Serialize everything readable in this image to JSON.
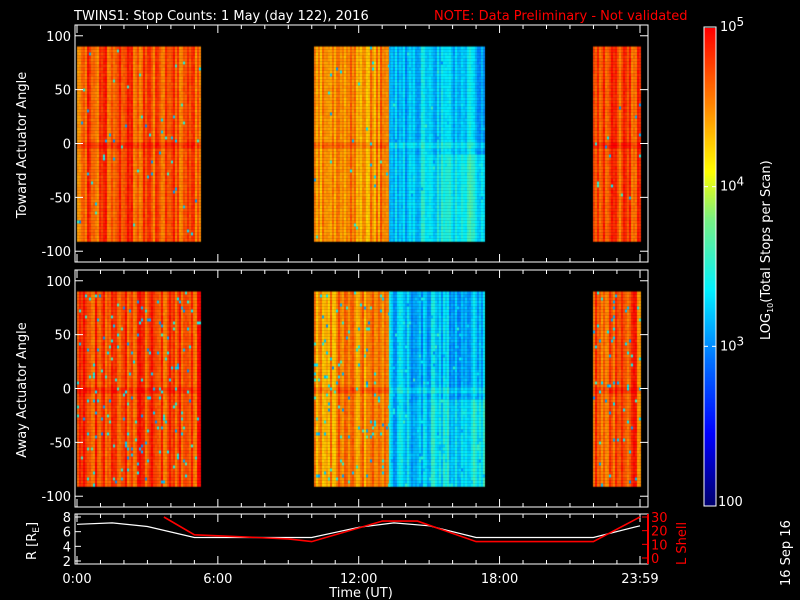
{
  "title": {
    "main": "TWINS1: Stop Counts:  1 May (day 122), 2016",
    "note": "NOTE: Data Preliminary - Not validated",
    "note_color": "#ff0000"
  },
  "chart_data": [
    {
      "type": "heatmap",
      "name": "toward",
      "ylabel": "Toward Actuator Angle",
      "ylim": [
        -110,
        110
      ],
      "yticks": [
        "100",
        "50",
        "0",
        "-50",
        "-100"
      ],
      "ytick_values": [
        100,
        50,
        0,
        -50,
        -100
      ],
      "angle_range": [
        -90,
        90
      ],
      "segments": [
        {
          "start_h": 0.0,
          "end_h": 5.3,
          "log10_counts": 4.7,
          "note": "orange/red with yellow stripes"
        },
        {
          "start_h": 10.1,
          "end_h": 13.3,
          "log10_counts": 4.5
        },
        {
          "start_h": 13.3,
          "end_h": 17.4,
          "log10_counts": 3.2
        },
        {
          "start_h": 22.0,
          "end_h": 24.0,
          "log10_counts": 4.7
        }
      ]
    },
    {
      "type": "heatmap",
      "name": "away",
      "ylabel": "Away Actuator Angle",
      "ylim": [
        -110,
        110
      ],
      "yticks": [
        "100",
        "50",
        "0",
        "-50",
        "-100"
      ],
      "ytick_values": [
        100,
        50,
        0,
        -50,
        -100
      ],
      "angle_range": [
        -90,
        90
      ],
      "segments": [
        {
          "start_h": 0.0,
          "end_h": 5.3,
          "log10_counts": 4.75
        },
        {
          "start_h": 10.1,
          "end_h": 13.3,
          "log10_counts": 4.5
        },
        {
          "start_h": 13.3,
          "end_h": 17.4,
          "log10_counts": 3.2
        },
        {
          "start_h": 22.0,
          "end_h": 24.0,
          "log10_counts": 4.7
        }
      ]
    },
    {
      "type": "line",
      "name": "orbit",
      "ylabel_left": "R [R",
      "ylabel_left_sub": "E",
      "ylabel_left_end": "]",
      "ylim_left": [
        2,
        8
      ],
      "yticks_left": [
        "8",
        "6",
        "4",
        "2"
      ],
      "ylabel_right": "L Shell",
      "ylim_right": [
        0,
        30
      ],
      "yticks_right": [
        "30",
        "20",
        "10",
        "0"
      ],
      "xlabel": "Time (UT)",
      "xlim": [
        0,
        24
      ],
      "xticks": [
        "0:00",
        "6:00",
        "12:00",
        "18:00",
        "23:59"
      ],
      "xtick_values": [
        0,
        6,
        12,
        18,
        23.98
      ],
      "series": [
        {
          "name": "R",
          "color": "#ffffff",
          "x": [
            0,
            1.5,
            3,
            5,
            10,
            12,
            13.5,
            15,
            17,
            22,
            24
          ],
          "y": [
            7,
            7.2,
            6.7,
            5.2,
            5.2,
            6.6,
            7.2,
            6.8,
            5.2,
            5.2,
            6.8
          ]
        },
        {
          "name": "L Shell",
          "color": "#ff0000",
          "x": [
            3.7,
            5,
            7,
            9,
            10,
            13,
            14.5,
            17,
            22,
            24
          ],
          "y": [
            30,
            17,
            15.5,
            14,
            12,
            27,
            27,
            12,
            12,
            30
          ]
        }
      ]
    }
  ],
  "colorbar": {
    "label_pre": "LOG",
    "label_sub": "10",
    "label_post": "(Total Stops per Scan)",
    "range_log10": [
      2,
      5
    ],
    "ticks": [
      {
        "base": "10",
        "exp": "5",
        "log": 5
      },
      {
        "base": "10",
        "exp": "4",
        "log": 4
      },
      {
        "base": "10",
        "exp": "3",
        "log": 3
      }
    ],
    "min_label": "100"
  },
  "footer_date": "16 Sep 16"
}
